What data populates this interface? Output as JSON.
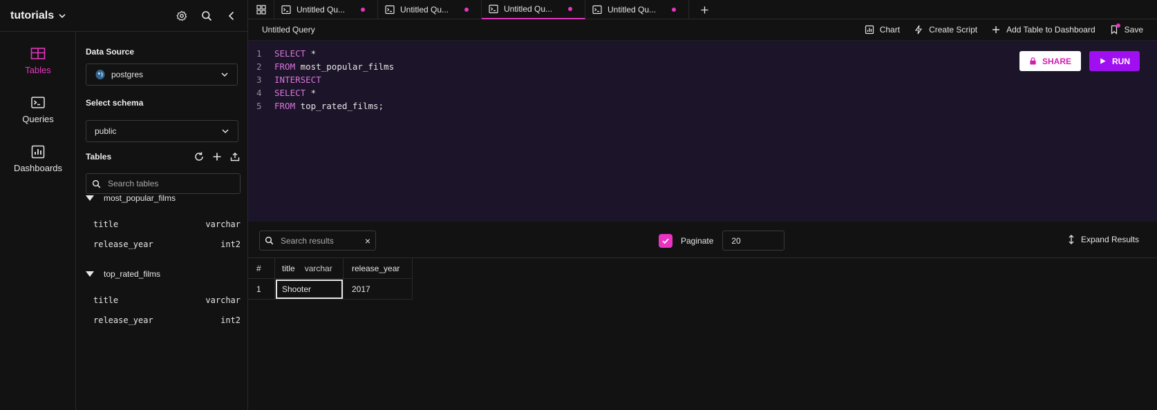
{
  "workspace": {
    "name": "tutorials"
  },
  "rail": {
    "items": [
      {
        "label": "Tables",
        "active": true
      },
      {
        "label": "Queries",
        "active": false
      },
      {
        "label": "Dashboards",
        "active": false
      }
    ]
  },
  "panel": {
    "data_source_label": "Data Source",
    "data_source_value": "postgres",
    "schema_label": "Select schema",
    "schema_value": "public",
    "tables_label": "Tables",
    "search_placeholder": "Search tables",
    "tables": [
      {
        "name": "most_popular_films",
        "columns": [
          {
            "name": "title",
            "type": "varchar"
          },
          {
            "name": "release_year",
            "type": "int2"
          }
        ]
      },
      {
        "name": "top_rated_films",
        "columns": [
          {
            "name": "title",
            "type": "varchar"
          },
          {
            "name": "release_year",
            "type": "int2"
          }
        ]
      }
    ]
  },
  "tabs": [
    {
      "label": "Untitled Qu...",
      "active": false
    },
    {
      "label": "Untitled Qu...",
      "active": false
    },
    {
      "label": "Untitled Qu...",
      "active": true
    },
    {
      "label": "Untitled Qu...",
      "active": false
    }
  ],
  "query_bar": {
    "title": "Untitled Query",
    "chart_label": "Chart",
    "create_script_label": "Create Script",
    "add_to_dashboard_label": "Add Table to Dashboard",
    "save_label": "Save"
  },
  "editor": {
    "share_label": "SHARE",
    "run_label": "RUN",
    "lines": [
      {
        "num": "1",
        "kw": "SELECT",
        "rest": " *"
      },
      {
        "num": "2",
        "kw": "FROM",
        "rest": " most_popular_films"
      },
      {
        "num": "3",
        "kw": "INTERSECT",
        "rest": ""
      },
      {
        "num": "4",
        "kw": "SELECT",
        "rest": " *"
      },
      {
        "num": "5",
        "kw": "FROM",
        "rest": " top_rated_films;"
      }
    ]
  },
  "results_bar": {
    "search_placeholder": "Search results",
    "clear_label": "×",
    "paginate_label": "Paginate",
    "paginate_value": "20",
    "expand_label": "Expand Results"
  },
  "results": {
    "headers": {
      "index": "#",
      "title": "title",
      "title_type": "varchar",
      "release_year": "release_year"
    },
    "rows": [
      {
        "index": "1",
        "title": "Shooter",
        "release_year": "2017"
      }
    ]
  },
  "colors": {
    "accent": "#e934c2",
    "run": "#a00ff0",
    "editor_bg": "#1c1428"
  }
}
